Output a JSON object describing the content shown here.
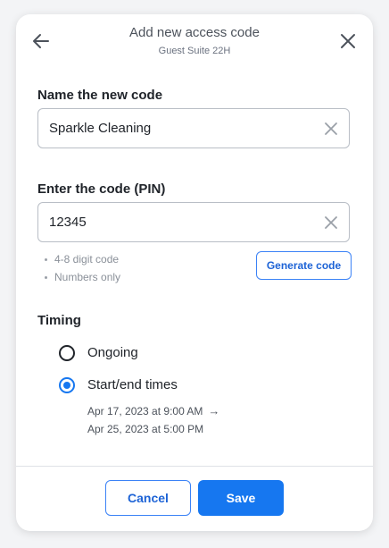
{
  "header": {
    "title": "Add new access code",
    "subtitle": "Guest Suite 22H",
    "back_icon": "arrow-left-icon",
    "close_icon": "close-icon"
  },
  "name_field": {
    "label": "Name the new code",
    "value": "Sparkle Cleaning",
    "clear_icon": "clear-icon"
  },
  "pin_field": {
    "label": "Enter the code (PIN)",
    "value": "12345",
    "clear_icon": "clear-icon",
    "hints": [
      "4-8 digit code",
      "Numbers only"
    ],
    "generate_label": "Generate code"
  },
  "timing": {
    "label": "Timing",
    "options": [
      {
        "label": "Ongoing",
        "checked": false
      },
      {
        "label": "Start/end times",
        "checked": true
      }
    ],
    "start": "Apr 17, 2023 at 9:00 AM",
    "arrow": "→",
    "end": "Apr 25, 2023 at 5:00 PM"
  },
  "footer": {
    "cancel_label": "Cancel",
    "save_label": "Save"
  },
  "colors": {
    "accent": "#1677f0",
    "outline": "#3b82f6",
    "background": "#f3f4f6"
  }
}
